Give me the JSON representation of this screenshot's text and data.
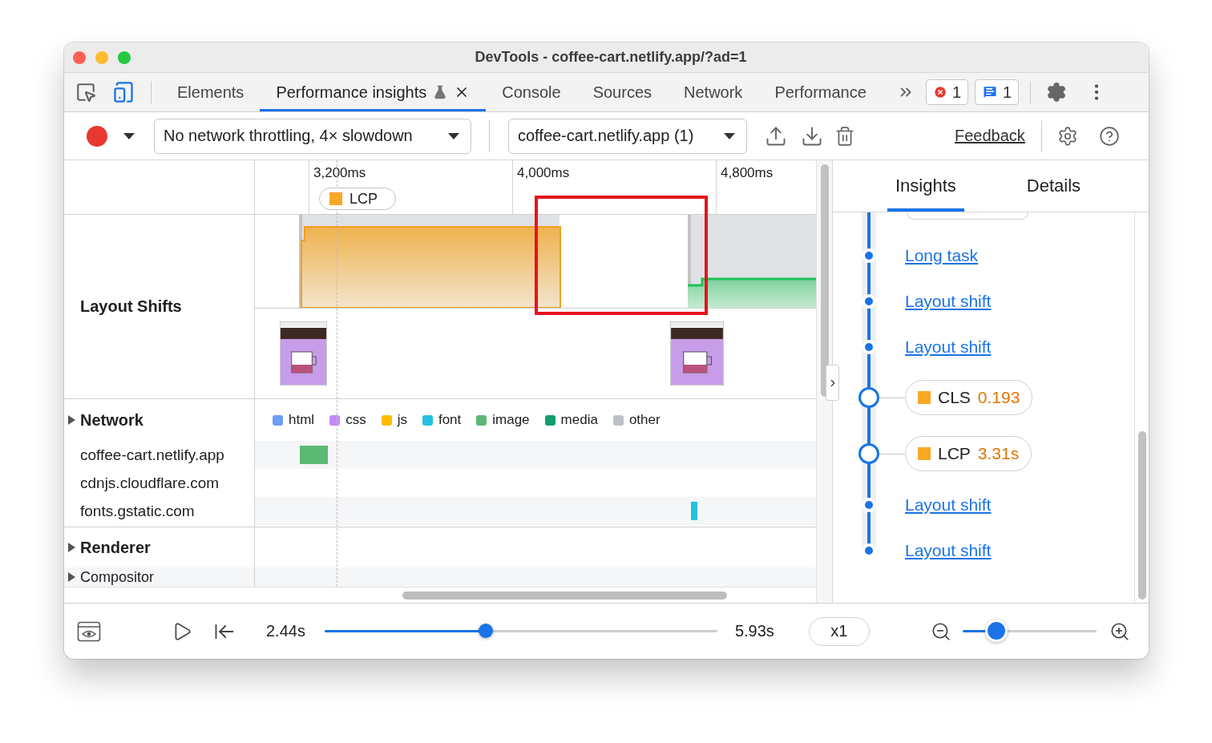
{
  "window": {
    "title": "DevTools - coffee-cart.netlify.app/?ad=1"
  },
  "tabs": [
    {
      "label": "Elements",
      "selected": false
    },
    {
      "label": "Performance insights",
      "selected": true,
      "experimental": true,
      "closable": true
    },
    {
      "label": "Console",
      "selected": false
    },
    {
      "label": "Sources",
      "selected": false
    },
    {
      "label": "Network",
      "selected": false
    },
    {
      "label": "Performance",
      "selected": false
    }
  ],
  "issues": {
    "errors": "1",
    "messages": "1"
  },
  "toolbar": {
    "throttling": "No network throttling, 4× slowdown",
    "target": "coffee-cart.netlify.app (1)",
    "feedback": "Feedback"
  },
  "ruler": {
    "ticks": [
      "3,200ms",
      "4,000ms",
      "4,800ms"
    ],
    "marker": "LCP"
  },
  "layout_shifts": {
    "label": "Layout Shifts"
  },
  "network": {
    "label": "Network",
    "expanded": false,
    "legend": [
      {
        "label": "html",
        "color": "#6c9ef5"
      },
      {
        "label": "css",
        "color": "#c58af9"
      },
      {
        "label": "js",
        "color": "#fbbc04"
      },
      {
        "label": "font",
        "color": "#24c1e0"
      },
      {
        "label": "image",
        "color": "#5bb974"
      },
      {
        "label": "media",
        "color": "#129c6f"
      },
      {
        "label": "other",
        "color": "#bdc1c6"
      }
    ],
    "hosts": [
      "coffee-cart.netlify.app",
      "cdnjs.cloudflare.com",
      "fonts.gstatic.com"
    ]
  },
  "tracks": [
    {
      "label": "Renderer",
      "expanded": false
    },
    {
      "label": "Compositor",
      "expanded": false
    }
  ],
  "sidepanel": {
    "tabs": [
      {
        "label": "Insights",
        "selected": true
      },
      {
        "label": "Details",
        "selected": false
      }
    ],
    "items": [
      {
        "kind": "link",
        "label": "Long task"
      },
      {
        "kind": "link",
        "label": "Layout shift"
      },
      {
        "kind": "link",
        "label": "Layout shift"
      },
      {
        "kind": "metric",
        "label": "CLS",
        "value": "0.193"
      },
      {
        "kind": "metric",
        "label": "LCP",
        "value": "3.31s"
      },
      {
        "kind": "link",
        "label": "Layout shift"
      },
      {
        "kind": "link",
        "label": "Layout shift"
      }
    ]
  },
  "playback": {
    "start": "2.44s",
    "end": "5.93s",
    "level": 0.41,
    "speed": "x1",
    "zoom": {
      "level": 0.25
    }
  }
}
